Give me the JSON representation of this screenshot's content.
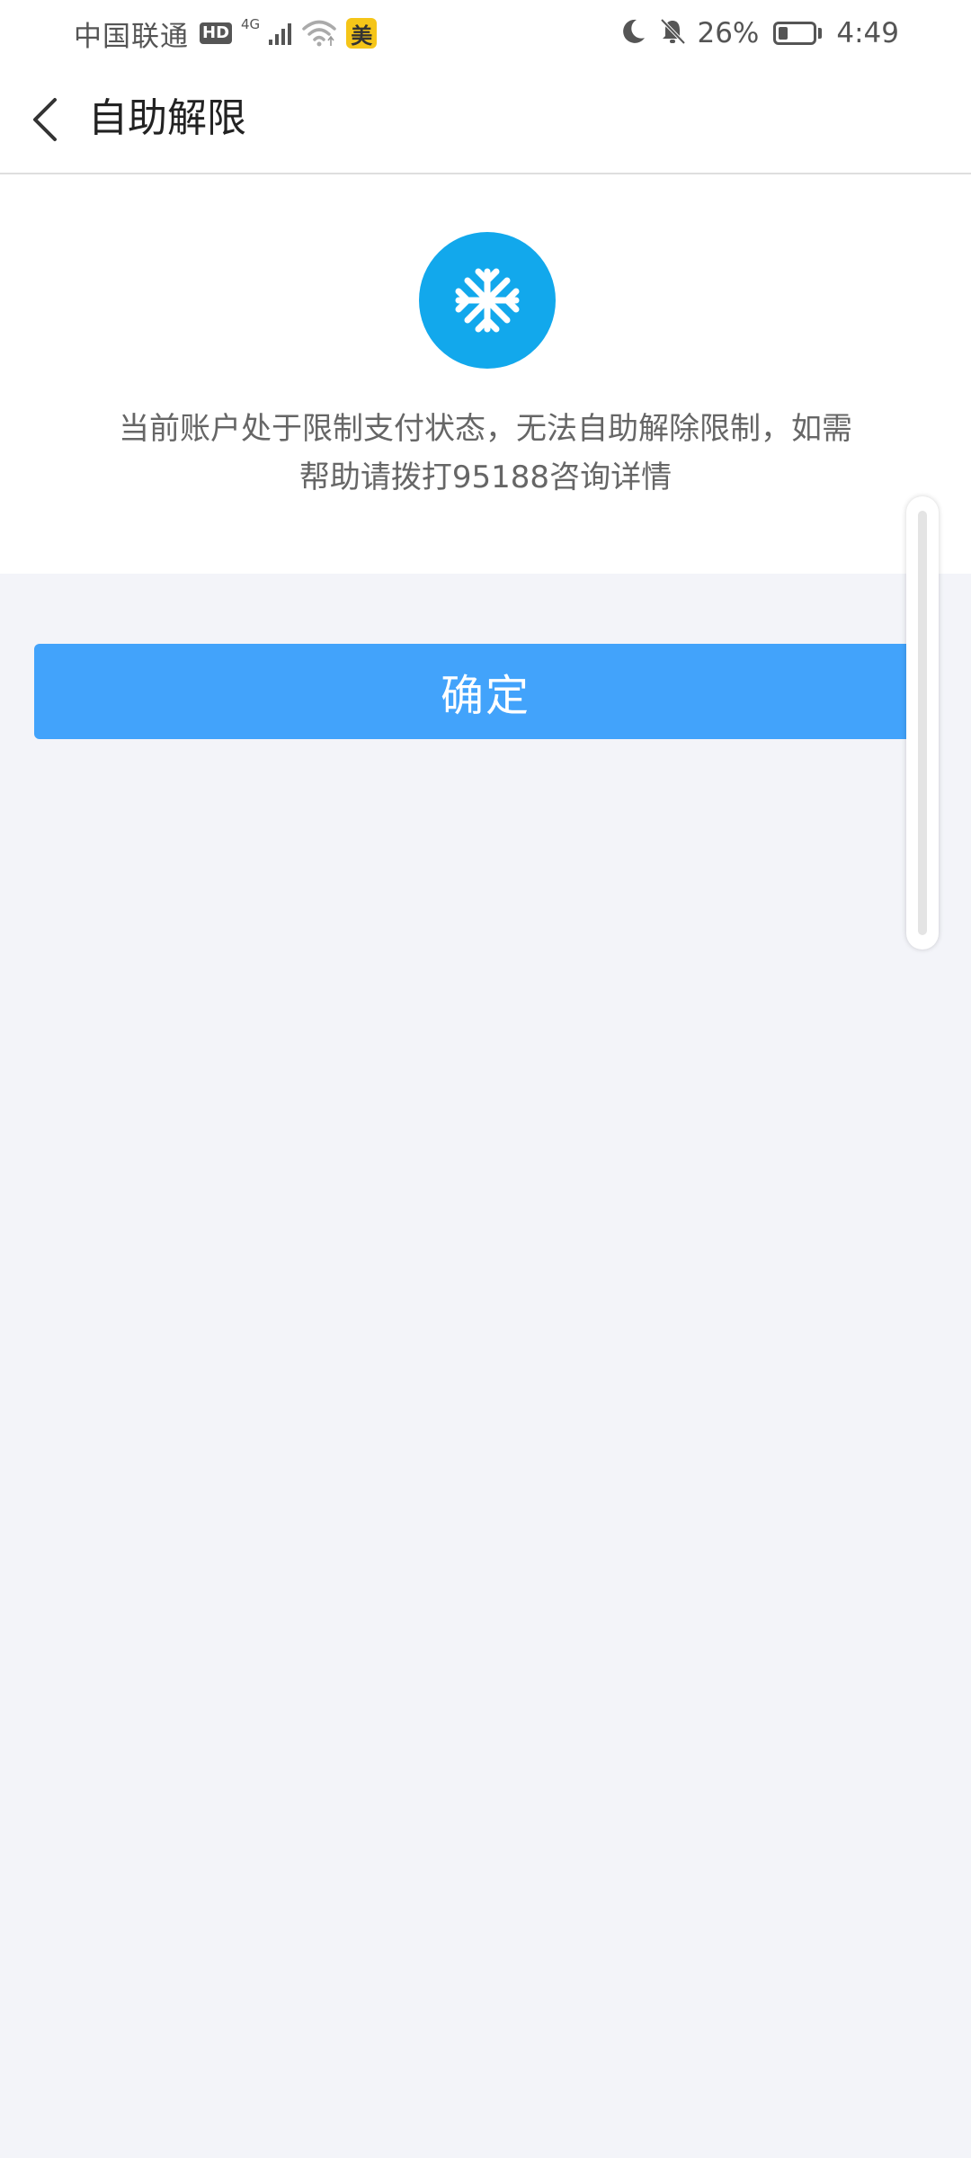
{
  "status_bar": {
    "carrier": "中国联通",
    "hd_badge": "HD",
    "network_type": "4G",
    "app_badge": "美",
    "battery_percent": "26%",
    "battery_level": 0.26,
    "time": "4:49",
    "icons": [
      "signal-icon",
      "wifi-icon",
      "moon-icon",
      "bell-muted-icon",
      "battery-icon"
    ]
  },
  "nav": {
    "back_icon": "chevron-left-icon",
    "title": "自助解限"
  },
  "panel": {
    "icon": "snowflake-icon",
    "icon_color": "#12a8ec",
    "message_line1": "当前账户处于限制支付状态，无法自助解除限制，如需",
    "message_line2": "帮助请拨打95188咨询详情"
  },
  "confirm_label": "确定",
  "colors": {
    "accent_button": "#42a3fb",
    "page_background": "#f3f4f9"
  }
}
